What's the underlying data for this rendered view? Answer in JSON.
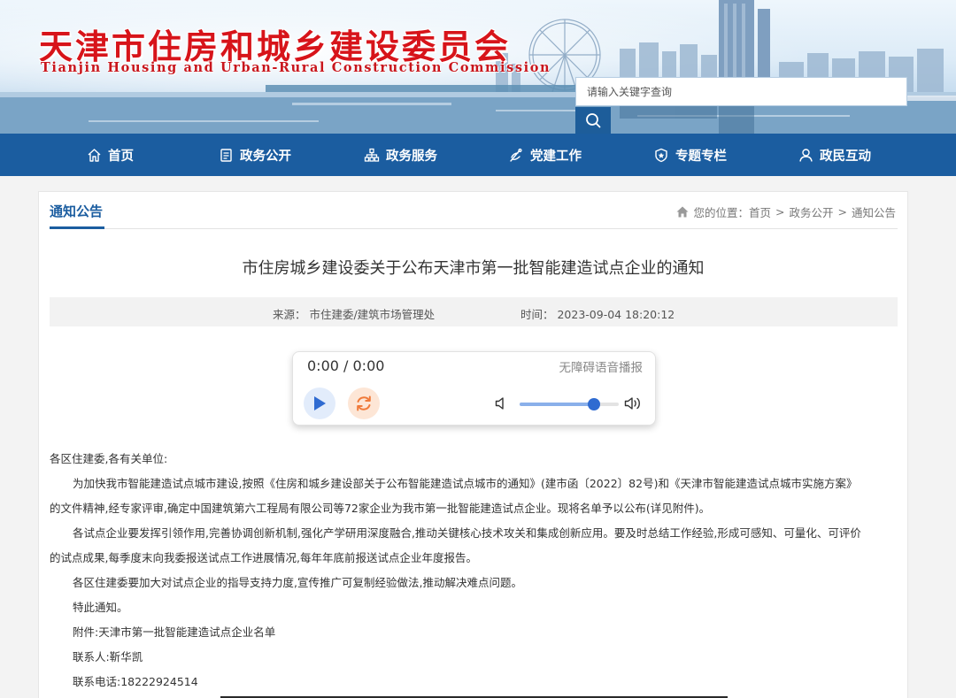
{
  "header": {
    "title_cn": "天津市住房和城乡建设委员会",
    "title_en": "Tianjin Housing and Urban-Rural Construction Commission",
    "search_placeholder": "请输入关键字查询",
    "search_icon": "search-icon"
  },
  "nav": {
    "items": [
      {
        "label": "首页",
        "icon": "home-icon"
      },
      {
        "label": "政务公开",
        "icon": "document-icon"
      },
      {
        "label": "政务服务",
        "icon": "network-icon"
      },
      {
        "label": "党建工作",
        "icon": "flag-icon"
      },
      {
        "label": "专题专栏",
        "icon": "badge-icon"
      },
      {
        "label": "政民互动",
        "icon": "user-icon"
      }
    ]
  },
  "section": {
    "title": "通知公告",
    "breadcrumb": {
      "prefix": "您的位置：",
      "items": [
        "首页",
        "政务公开",
        "通知公告"
      ],
      "separator": ">"
    }
  },
  "article": {
    "title": "市住房城乡建设委关于公布天津市第一批智能建造试点企业的通知",
    "source": "来源： 市住建委/建筑市场管理处",
    "time": "时间： 2023-09-04 18:20:12"
  },
  "player": {
    "time": "0:00 / 0:00",
    "label": "无障碍语音播报",
    "volume_fraction": 0.75
  },
  "body": {
    "salutation": "各区住建委,各有关单位:",
    "p1_line1": "为加快我市智能建造试点城市建设,按照《住房和城乡建设部关于公布智能建造试点城市的通知》(建市函〔2022〕82号)和《天津市智能建造试点城市实施方案》",
    "p1_line2": "的文件精神,经专家评审,确定中国建筑第六工程局有限公司等72家企业为我市第一批智能建造试点企业。现将名单予以公布(详见附件)。",
    "p2_line1": "各试点企业要发挥引领作用,完善协调创新机制,强化产学研用深度融合,推动关键核心技术攻关和集成创新应用。要及时总结工作经验,形成可感知、可量化、可评价",
    "p2_line2": "的试点成果,每季度末向我委报送试点工作进展情况,每年年底前报送试点企业年度报告。",
    "p3": "各区住建委要加大对试点企业的指导支持力度,宣传推广可复制经验做法,推动解决难点问题。",
    "p4": "特此通知。",
    "attachment": "附件:天津市第一批智能建造试点企业名单",
    "contact": "联系人:靳华凯",
    "phone": "联系电话:18222924514"
  },
  "colors": {
    "nav_bg": "#1b5da0",
    "title_red": "#d7141a",
    "accent_blue": "#1b5da0",
    "play_blue": "#2f6bd1",
    "replay_orange": "#f07a3a"
  }
}
